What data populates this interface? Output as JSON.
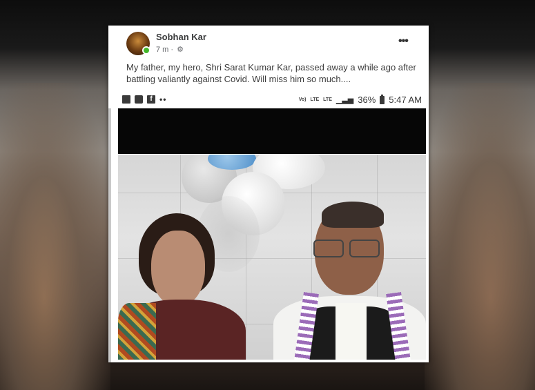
{
  "post": {
    "author": "Sobhan Kar",
    "time": "7 m",
    "separator": "·",
    "more_label": "•••",
    "caption": "My father, my hero, Shri Sarat Kumar Kar, passed away a while ago after battling valiantly against Covid. Will miss him so much...."
  },
  "statusbar": {
    "icons_left": [
      "gallery-icon",
      "message-icon",
      "facebook-icon"
    ],
    "dots": "••",
    "volte": "Vo)",
    "lte1": "LTE",
    "lte2": "LTE",
    "battery_percent": "36%",
    "time": "5:47 AM"
  },
  "colors": {
    "online": "#42b72a",
    "text_dark": "#3a3b3c",
    "text_muted": "#65676b"
  }
}
